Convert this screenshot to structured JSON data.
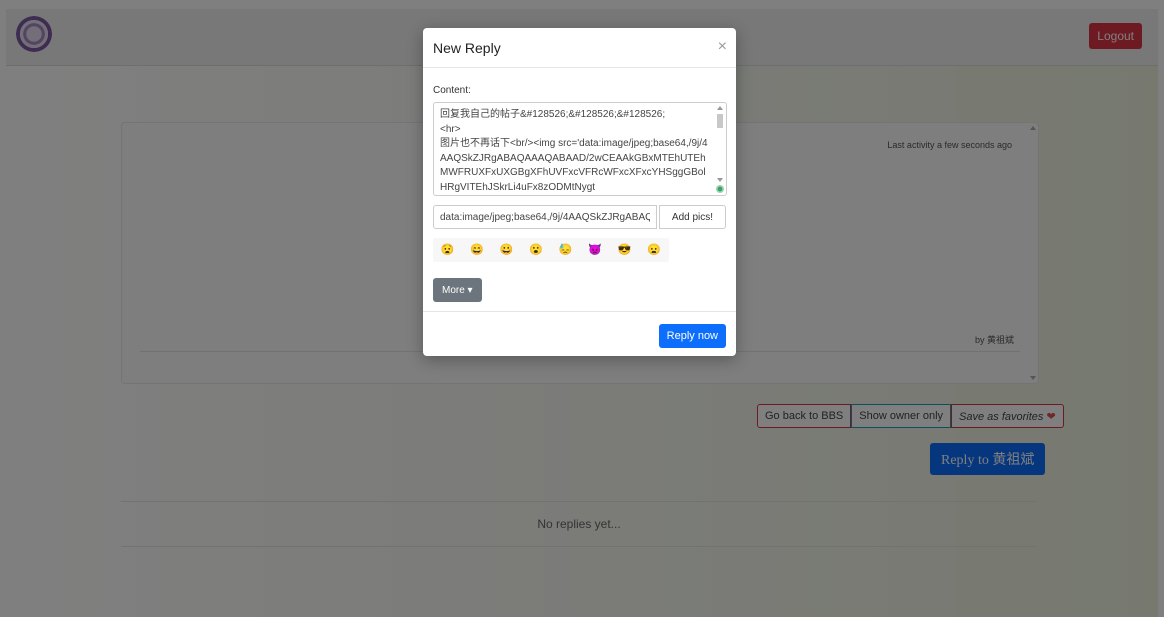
{
  "header": {
    "logout_label": "Logout"
  },
  "post": {
    "activity": "Last activity a few seconds ago",
    "byline": "by 黄祖斌"
  },
  "actions": {
    "back_label": "Go back to BBS",
    "owner_label": "Show owner only",
    "favorites_label": "Save as favorites",
    "reply_to_label": "Reply to 黄祖斌"
  },
  "replies": {
    "empty_text": "No replies yet..."
  },
  "modal": {
    "title": "New Reply",
    "close_symbol": "×",
    "content_label": "Content:",
    "content_value": "回复我自己的帖子&#128526;&#128526;&#128526;\n<hr>\n图片也不再话下<br/><img src='data:image/jpeg;base64,/9j/4AAQSkZJRgABAQAAAQABAAD/2wCEAAkGBxMTEhUTEhMWFRUXFxUXGBgXFhUVFxcVFRcWFxcXFxcYHSggGBolHRgVITEhJSkrLi4uFx8zODMtNygt",
    "pic_input_value": "data:image/jpeg;base64,/9j/4AAQSkZJRgABAQAA",
    "add_pics_label": "Add pics!",
    "emojis": [
      "😧",
      "😄",
      "😀",
      "😮",
      "😓",
      "👿",
      "😎",
      "😦"
    ],
    "more_label": "More ▾",
    "reply_now_label": "Reply now"
  },
  "colors": {
    "primary": "#0d6efd",
    "danger": "#dc3545",
    "secondary": "#6c757d",
    "info": "#17a2b8"
  }
}
